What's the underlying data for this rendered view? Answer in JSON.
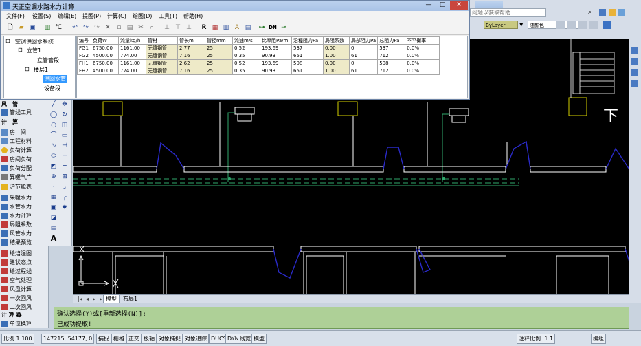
{
  "window": {
    "title": "天正空调水路水力计算"
  },
  "menu": [
    "文件(F)",
    "设置(S)",
    "编辑(E)",
    "提图(P)",
    "计算(C)",
    "绘图(D)",
    "工具(T)",
    "帮助(H)"
  ],
  "search": {
    "placeholder": "问题以获取帮助"
  },
  "tree": {
    "root": "空调供回水系统",
    "riser": "立管1",
    "riser_segment": "立管管段",
    "floor": "楼层1",
    "supply_return": "供回水管",
    "equipment": "设备段"
  },
  "table": {
    "headers": [
      "编号",
      "负荷W",
      "流量kg/h",
      "管材",
      "管长m",
      "管径mm",
      "流速m/s",
      "比摩阻Pa/m",
      "沿程阻力Pa",
      "局阻系数",
      "局部阻力Pa",
      "总阻力Pa",
      "不平衡率"
    ],
    "rows": [
      [
        "FG1",
        "6750.00",
        "1161.00",
        "无缝钢管",
        "2.77",
        "25",
        "0.52",
        "193.69",
        "537",
        "0.00",
        "0",
        "537",
        "0.0%"
      ],
      [
        "FG2",
        "4500.00",
        "774.00",
        "无缝钢管",
        "7.16",
        "25",
        "0.35",
        "90.93",
        "651",
        "1.00",
        "61",
        "712",
        "0.0%"
      ],
      [
        "FH1",
        "6750.00",
        "1161.00",
        "无缝钢管",
        "2.62",
        "25",
        "0.52",
        "193.69",
        "508",
        "0.00",
        "0",
        "508",
        "0.0%"
      ],
      [
        "FH2",
        "4500.00",
        "774.00",
        "无缝钢管",
        "7.16",
        "25",
        "0.35",
        "90.93",
        "651",
        "1.00",
        "61",
        "712",
        "0.0%"
      ]
    ]
  },
  "layer": {
    "linetype": "ByLayer",
    "color": "随颜色"
  },
  "palette": {
    "section_wind": "风　管",
    "pipe_tools": "管线工具",
    "section_calc": "计　算",
    "room": "房　间",
    "material": "工程材料",
    "load_calc": "负荷计算",
    "room_load": "房间负荷",
    "load_dist": "负荷分配",
    "radiator": "算暖气片",
    "energy": "沪节能表",
    "heating_hydraulic": "采暖水力",
    "pipe_hydraulic": "水管水力",
    "hydraulic_calc": "水力计算",
    "local_coef": "局阻系数",
    "duct_hydraulic": "风管水力",
    "result_preview": "结果预览",
    "psychro": "绘焓湿图",
    "state_point": "建状态点",
    "process_line": "绘过程线",
    "air_treatment": "空气处理",
    "wind_calc": "风盘计算",
    "primary_return": "一次回风",
    "secondary_return": "二次回风",
    "section_calculator": "计 算 器",
    "unit_convert": "单位换算"
  },
  "draw_tools_text": {
    "text_tool": "A"
  },
  "tabs": {
    "model": "模型",
    "layout": "布局1"
  },
  "command": {
    "line1": "确认选择(Y)或[重新选择(N)]:",
    "line2": "已成功提取!"
  },
  "status": {
    "scale": "比例 1:100",
    "coords": "147215, 54177, 0",
    "toggles": [
      "捕捉",
      "栅格",
      "正交",
      "极轴",
      "对象捕捉",
      "对象追踪",
      "DUCS",
      "DYN",
      "线宽",
      "模型"
    ],
    "annotation_scale": "注释比例: 1:1",
    "right_label": "编组"
  },
  "cad_labels": {
    "riser_mark": "下"
  },
  "colors": {
    "accent": "#3399ff",
    "command_bg": "#aed097",
    "highlight_cell": "#eeeac8"
  }
}
